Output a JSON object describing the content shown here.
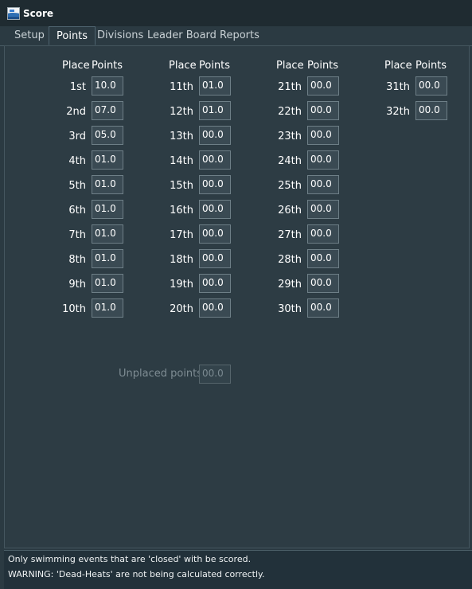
{
  "window": {
    "title": "Score"
  },
  "tabs": [
    {
      "label": "Setup"
    },
    {
      "label": "Points"
    },
    {
      "label": "Divisions"
    },
    {
      "label": "Leader Board"
    },
    {
      "label": "Reports"
    }
  ],
  "headers": {
    "place": "Place",
    "points": "Points"
  },
  "columns": [
    [
      {
        "place": "1st",
        "points": "10.0"
      },
      {
        "place": "2nd",
        "points": "07.0"
      },
      {
        "place": "3rd",
        "points": "05.0"
      },
      {
        "place": "4th",
        "points": "01.0"
      },
      {
        "place": "5th",
        "points": "01.0"
      },
      {
        "place": "6th",
        "points": "01.0"
      },
      {
        "place": "7th",
        "points": "01.0"
      },
      {
        "place": "8th",
        "points": "01.0"
      },
      {
        "place": "9th",
        "points": "01.0"
      },
      {
        "place": "10th",
        "points": "01.0"
      }
    ],
    [
      {
        "place": "11th",
        "points": "01.0"
      },
      {
        "place": "12th",
        "points": "01.0"
      },
      {
        "place": "13th",
        "points": "00.0"
      },
      {
        "place": "14th",
        "points": "00.0"
      },
      {
        "place": "15th",
        "points": "00.0"
      },
      {
        "place": "16th",
        "points": "00.0"
      },
      {
        "place": "17th",
        "points": "00.0"
      },
      {
        "place": "18th",
        "points": "00.0"
      },
      {
        "place": "19th",
        "points": "00.0"
      },
      {
        "place": "20th",
        "points": "00.0"
      }
    ],
    [
      {
        "place": "21th",
        "points": "00.0"
      },
      {
        "place": "22th",
        "points": "00.0"
      },
      {
        "place": "23th",
        "points": "00.0"
      },
      {
        "place": "24th",
        "points": "00.0"
      },
      {
        "place": "25th",
        "points": "00.0"
      },
      {
        "place": "26th",
        "points": "00.0"
      },
      {
        "place": "27th",
        "points": "00.0"
      },
      {
        "place": "28th",
        "points": "00.0"
      },
      {
        "place": "29th",
        "points": "00.0"
      },
      {
        "place": "30th",
        "points": "00.0"
      }
    ],
    [
      {
        "place": "31th",
        "points": "00.0"
      },
      {
        "place": "32th",
        "points": "00.0"
      }
    ]
  ],
  "unplaced": {
    "label": "Unplaced points",
    "value": "00.0"
  },
  "status": {
    "line1": "Only swimming events that are 'closed' with be scored.",
    "line2": "WARNING: 'Dead-Heats' are not being calculated correctly."
  },
  "colors": {
    "background": "#2b3a42",
    "titlebar": "#1f2b31",
    "field": "#3a4a53"
  }
}
